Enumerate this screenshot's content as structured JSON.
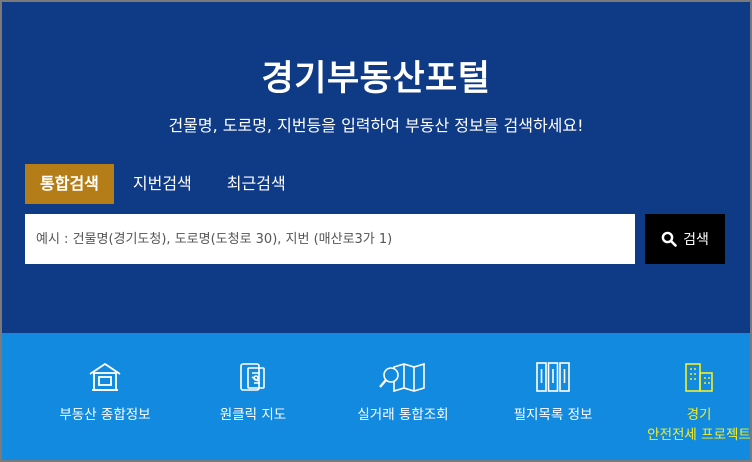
{
  "hero": {
    "title": "경기부동산포털",
    "subtitle": "건물명, 도로명, 지번등을 입력하여 부동산 정보를 검색하세요!"
  },
  "tabs": [
    {
      "label": "통합검색",
      "active": true
    },
    {
      "label": "지번검색",
      "active": false
    },
    {
      "label": "최근검색",
      "active": false
    }
  ],
  "search": {
    "placeholder": "예시 : 건물명(경기도청), 도로명(도청로 30), 지번 (매산로3가 1)",
    "button_label": "검색"
  },
  "quick_menu": [
    {
      "label": "부동산 종합정보",
      "icon": "house-icon"
    },
    {
      "label": "원클릭 지도",
      "icon": "map-phone-icon"
    },
    {
      "label": "실거래 통합조회",
      "icon": "map-search-icon"
    },
    {
      "label": "필지목록 정보",
      "icon": "parcel-list-icon"
    },
    {
      "label": "경기",
      "label2": "안전전세 프로젝트",
      "icon": "building-icon"
    }
  ],
  "colors": {
    "hero_bg": "#0f3a86",
    "tab_active": "#b57d18",
    "quick_bg": "#128ae0",
    "highlight": "#f4ee2a"
  }
}
